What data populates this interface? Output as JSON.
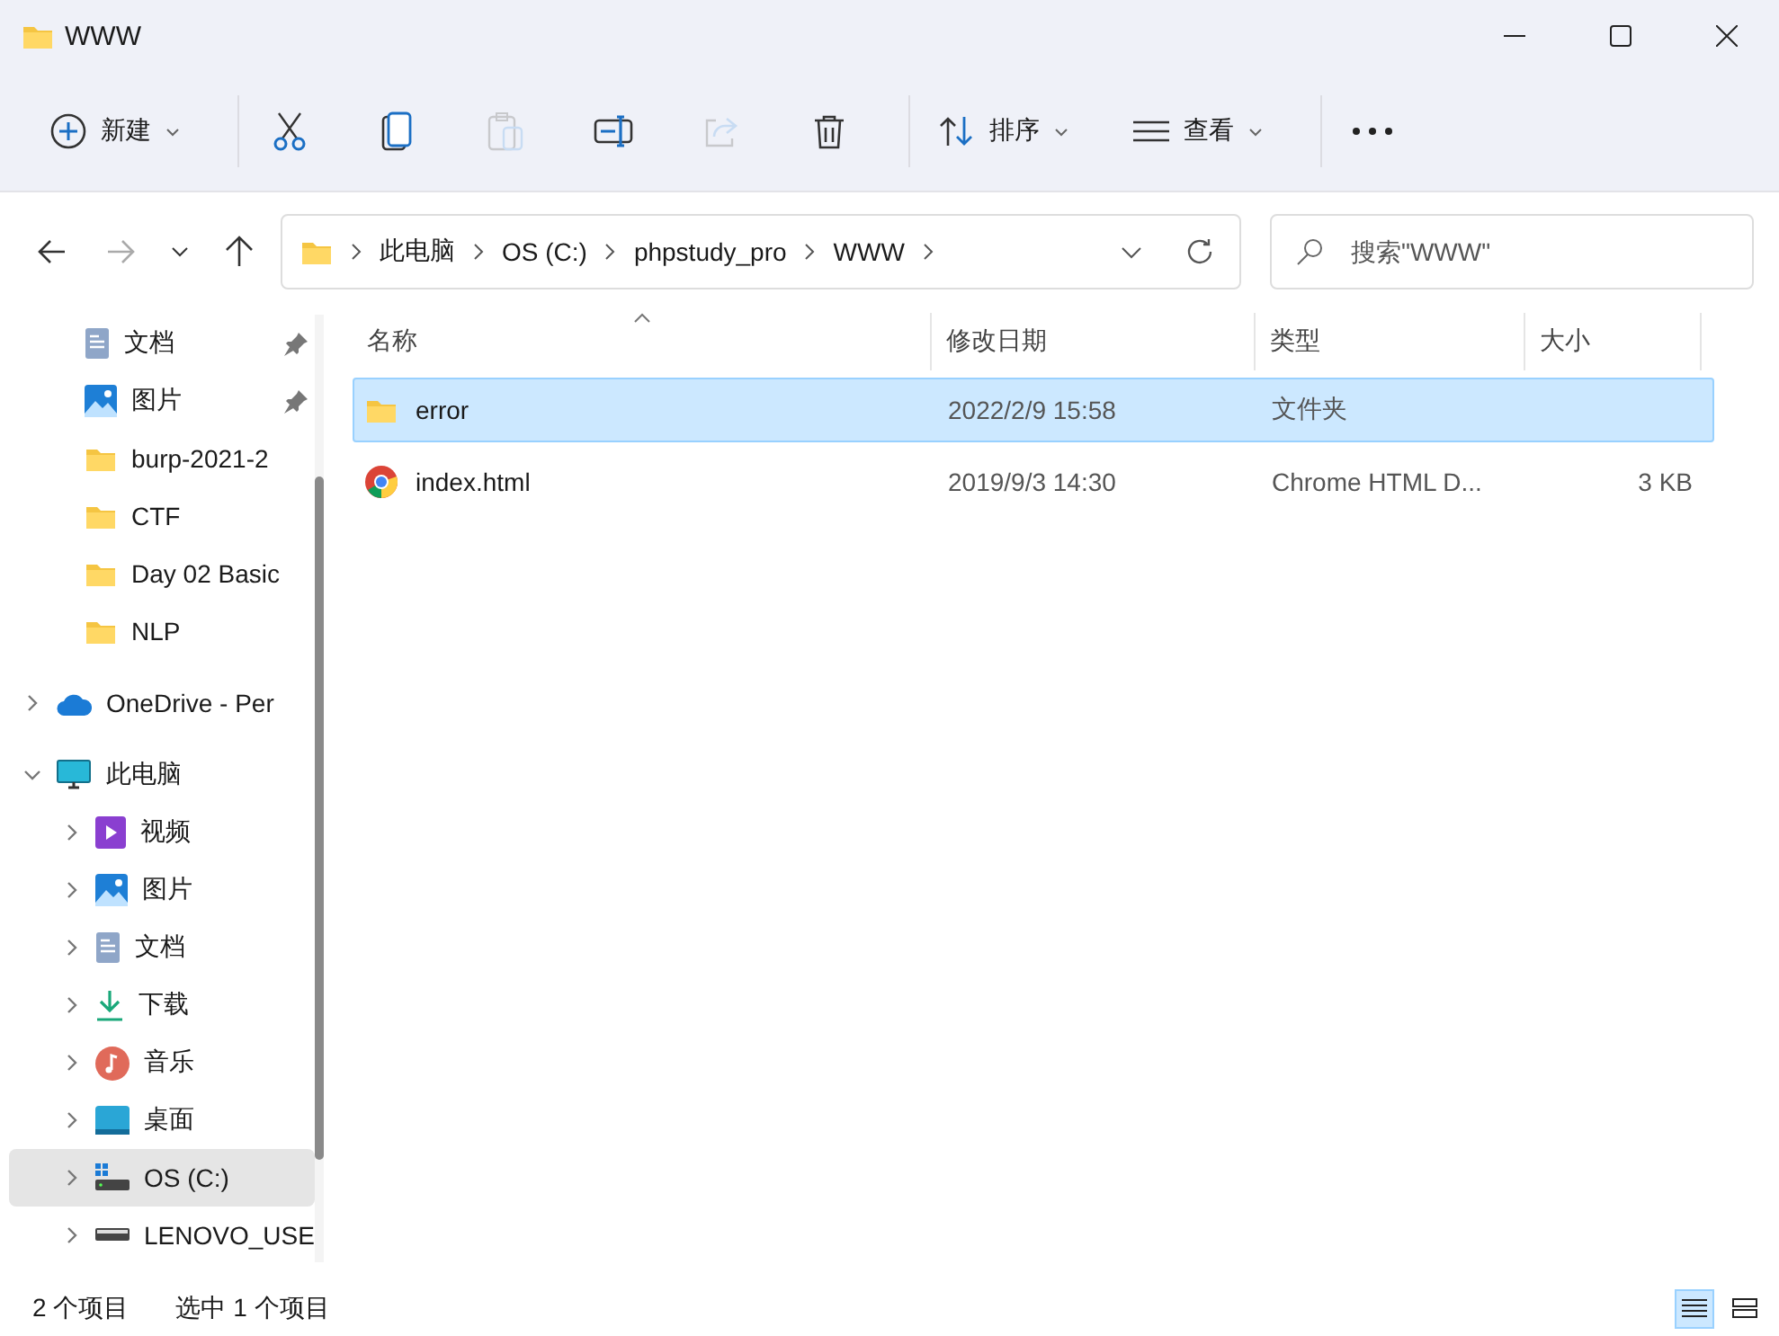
{
  "window": {
    "title": "WWW"
  },
  "toolbar": [
    {
      "kind": "new",
      "label": "新建",
      "dropdown": true,
      "disabled": false
    },
    {
      "kind": "cut",
      "disabled": false
    },
    {
      "kind": "copy",
      "disabled": false
    },
    {
      "kind": "paste",
      "disabled": true
    },
    {
      "kind": "rename",
      "disabled": false
    },
    {
      "kind": "share",
      "disabled": true
    },
    {
      "kind": "delete",
      "disabled": false
    },
    {
      "kind": "sort",
      "label": "排序",
      "dropdown": true,
      "disabled": false
    },
    {
      "kind": "view",
      "label": "查看",
      "dropdown": true,
      "disabled": false
    },
    {
      "kind": "more",
      "disabled": false
    }
  ],
  "nav": {
    "back_disabled": false,
    "forward_disabled": true
  },
  "address": {
    "crumbs": [
      "此电脑",
      "OS (C:)",
      "phpstudy_pro",
      "WWW"
    ]
  },
  "search": {
    "placeholder": "搜索\"WWW\""
  },
  "quick_access": [
    {
      "kind": "doc",
      "label": "文档",
      "pinned": true,
      "selected": false
    },
    {
      "kind": "picture",
      "label": "图片",
      "pinned": true,
      "selected": false
    },
    {
      "kind": "folder",
      "label": "burp-2021-2",
      "pinned": false,
      "selected": false
    },
    {
      "kind": "folder",
      "label": "CTF",
      "pinned": false,
      "selected": false
    },
    {
      "kind": "folder",
      "label": "Day 02 Basic",
      "pinned": false,
      "selected": false
    },
    {
      "kind": "folder",
      "label": "NLP",
      "pinned": false,
      "selected": false
    }
  ],
  "tree": [
    {
      "kind": "cloud",
      "label": "OneDrive - Per",
      "expanded": false,
      "selected": false
    },
    {
      "kind": "pc",
      "label": "此电脑",
      "expanded": true,
      "selected": false,
      "children": [
        {
          "kind": "video",
          "label": "视频",
          "expanded": false,
          "selected": false
        },
        {
          "kind": "picture",
          "label": "图片",
          "expanded": false,
          "selected": false
        },
        {
          "kind": "doc",
          "label": "文档",
          "expanded": false,
          "selected": false
        },
        {
          "kind": "download",
          "label": "下载",
          "expanded": false,
          "selected": false
        },
        {
          "kind": "music",
          "label": "音乐",
          "expanded": false,
          "selected": false
        },
        {
          "kind": "desktop",
          "label": "桌面",
          "expanded": false,
          "selected": false
        },
        {
          "kind": "drive-os",
          "label": "OS (C:)",
          "expanded": false,
          "selected": true
        },
        {
          "kind": "drive",
          "label": "LENOVO_USE",
          "expanded": false,
          "selected": false
        }
      ]
    }
  ],
  "table": {
    "columns": [
      {
        "label": "名称",
        "sorted": true
      },
      {
        "label": "修改日期",
        "sorted": false
      },
      {
        "label": "类型",
        "sorted": false
      },
      {
        "label": "大小",
        "sorted": false
      }
    ],
    "rows": [
      {
        "kind": "folder",
        "name": "error",
        "date": "2022/2/9 15:58",
        "type": "文件夹",
        "size": "",
        "selected": true
      },
      {
        "kind": "html",
        "name": "index.html",
        "date": "2019/9/3 14:30",
        "type": "Chrome HTML D...",
        "size": "3 KB",
        "selected": false
      }
    ]
  },
  "status_bar": {
    "count": "2 个项目",
    "selection": "选中 1 个项目",
    "views": [
      {
        "kind": "details",
        "selected": true
      },
      {
        "kind": "tiles",
        "selected": false
      }
    ]
  }
}
